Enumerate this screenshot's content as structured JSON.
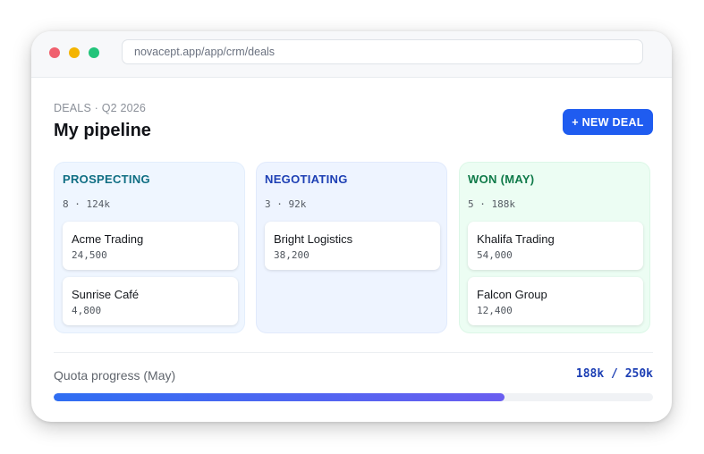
{
  "browser": {
    "url": "novacept.app/app/crm/deals"
  },
  "header": {
    "eyebrow": "DEALS · Q2 2026",
    "title": "My pipeline",
    "new_deal_label": "+ NEW DEAL"
  },
  "columns": [
    {
      "title": "PROSPECTING",
      "meta": "8 · 124k",
      "cards": [
        {
          "name": "Acme Trading",
          "value": "24,500"
        },
        {
          "name": "Sunrise Café",
          "value": "4,800"
        }
      ]
    },
    {
      "title": "NEGOTIATING",
      "meta": "3 · 92k",
      "cards": [
        {
          "name": "Bright Logistics",
          "value": "38,200"
        }
      ]
    },
    {
      "title": "WON (MAY)",
      "meta": "5 · 188k",
      "cards": [
        {
          "name": "Khalifa Trading",
          "value": "54,000"
        },
        {
          "name": "Falcon Group",
          "value": "12,400"
        }
      ]
    }
  ],
  "quota": {
    "label": "Quota progress (May)",
    "value_text": "188k / 250k",
    "progress": 0.752
  },
  "colors": {
    "accent": "#1f5cf0",
    "prospecting": "#0f6e83",
    "negotiating": "#1d3fb4",
    "won": "#0f7a49"
  }
}
